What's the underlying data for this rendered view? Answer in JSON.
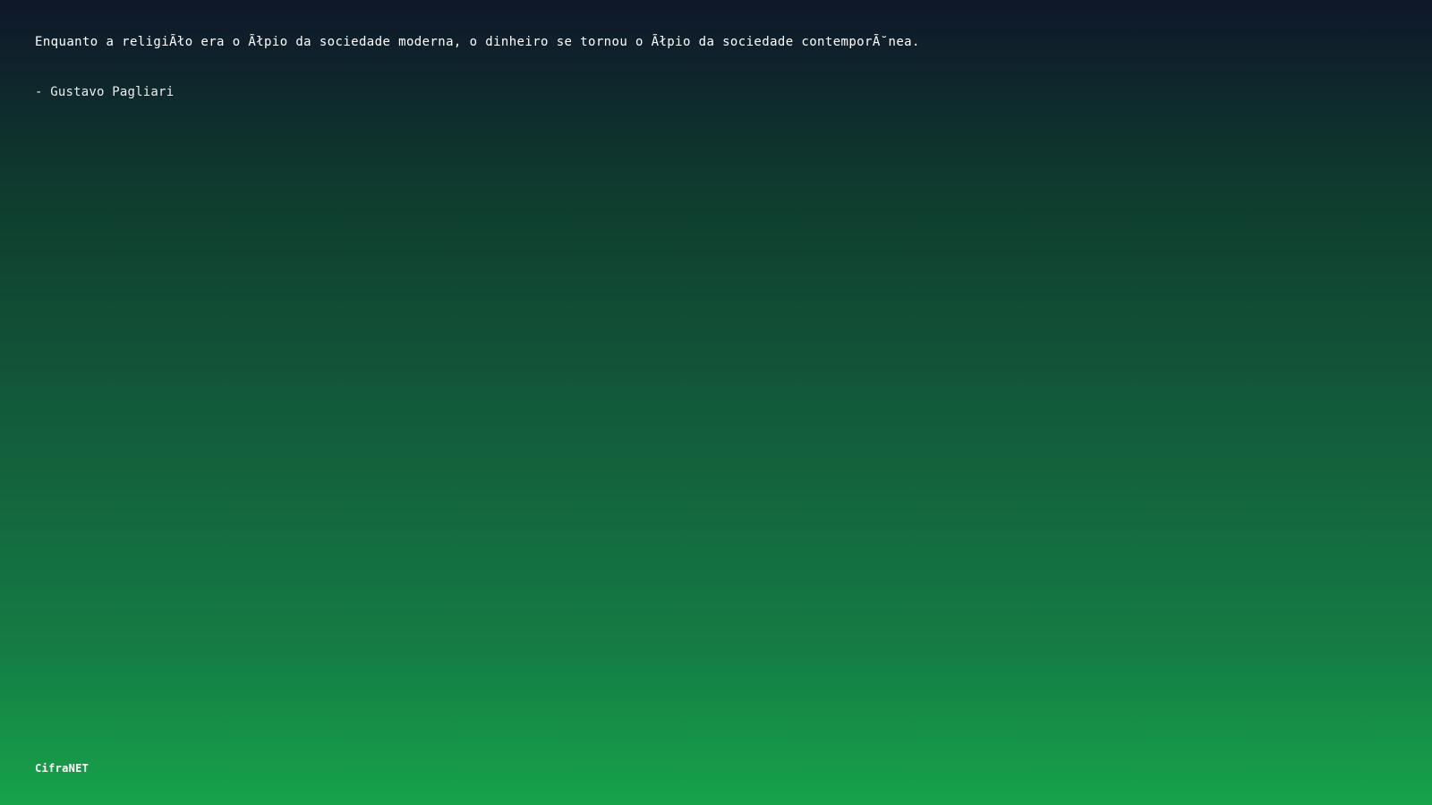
{
  "quote": {
    "text": "Enquanto a religiÃło era o Ãłpio da sociedade moderna, o dinheiro se tornou o Ãłpio da sociedade contemporÃ˘nea.",
    "author": "- Gustavo Pagliari"
  },
  "footer": {
    "brand": "CifraNET"
  },
  "colors": {
    "gradient_top": "#0f172a",
    "gradient_bottom": "#16a34a",
    "text": "#ffffff"
  }
}
